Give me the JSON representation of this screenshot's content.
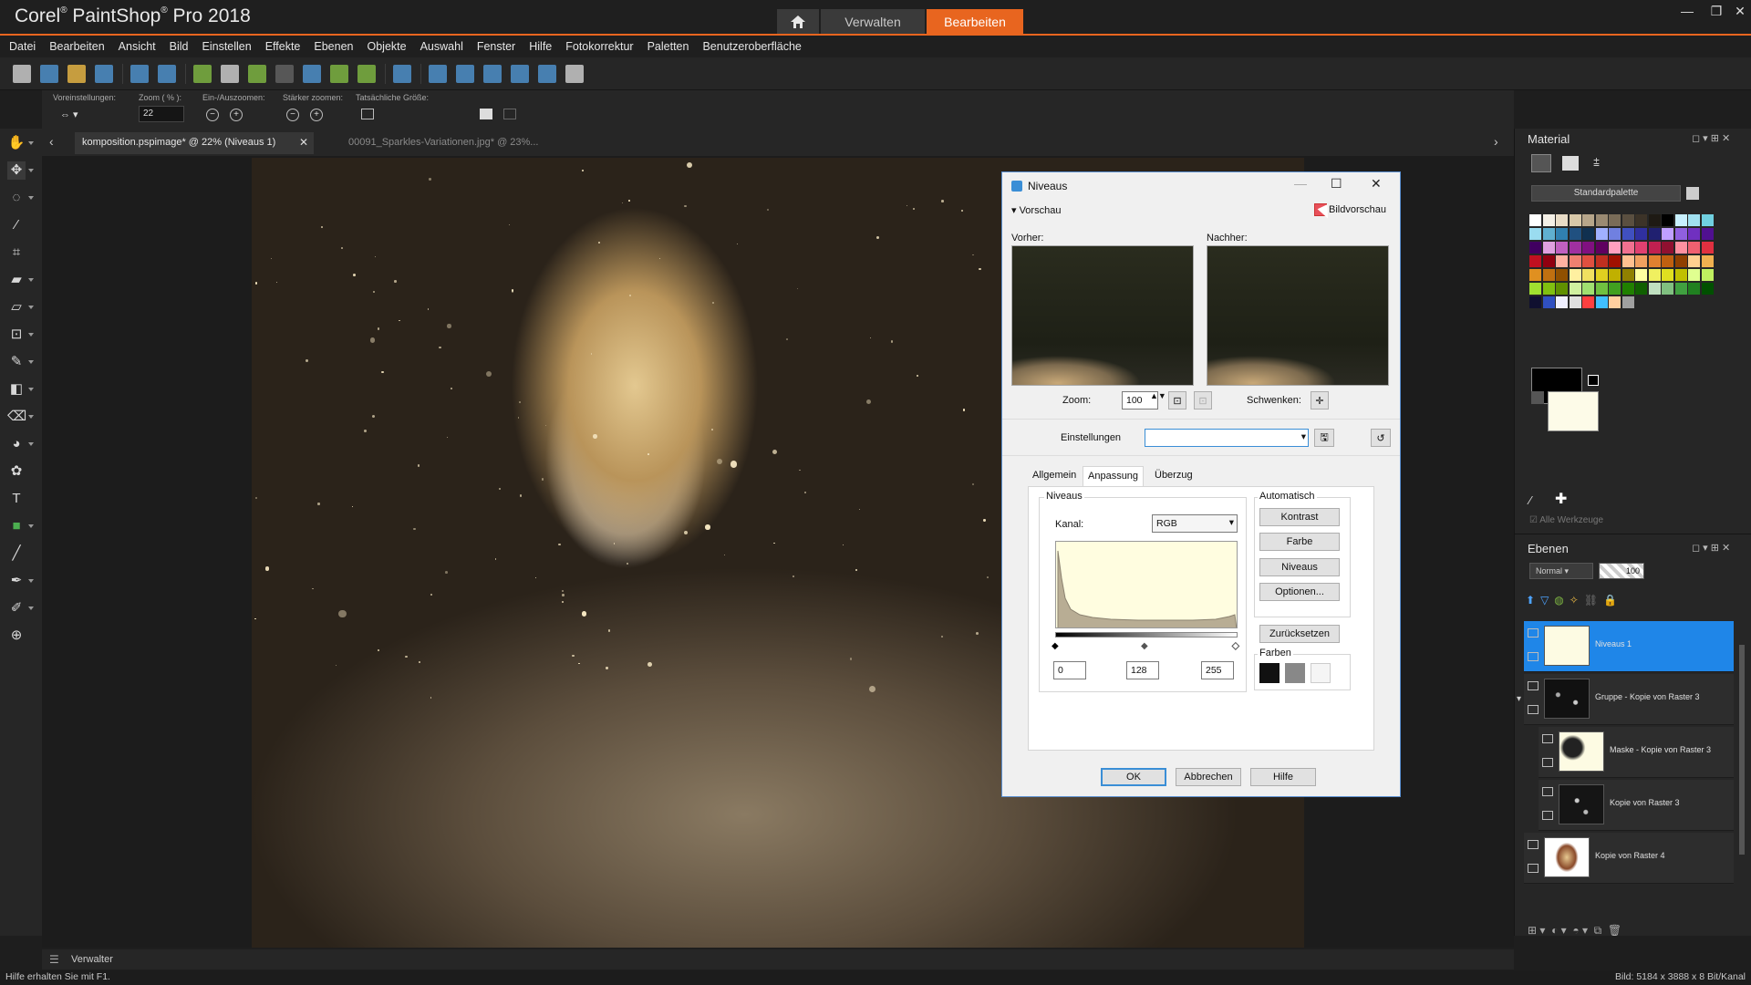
{
  "app": {
    "title_brand": "Corel",
    "title_product": "PaintShop",
    "title_rest": "Pro 2018",
    "home_icon": "home-icon",
    "tabs": [
      {
        "label": "Verwalten",
        "active": false
      },
      {
        "label": "Bearbeiten",
        "active": true
      }
    ],
    "accent": "#e8651f"
  },
  "menu": [
    "Datei",
    "Bearbeiten",
    "Ansicht",
    "Bild",
    "Einstellen",
    "Effekte",
    "Ebenen",
    "Objekte",
    "Auswahl",
    "Fenster",
    "Hilfe",
    "Fotokorrektur",
    "Paletten",
    "Benutzeroberfläche"
  ],
  "tool_options": {
    "presets_label": "Voreinstellungen:",
    "zoom_label": "Zoom ( % ):",
    "zoom_value": "22",
    "zoom_inout_label": "Ein-/Auszoomen:",
    "more_zoom_label": "Stärker zoomen:",
    "actual_size_label": "Tatsächliche Größe:"
  },
  "documents": {
    "active": "komposition.pspimage* @  22% (Niveaus 1)",
    "inactive": "00091_Sparkles-Variationen.jpg* @  23%..."
  },
  "dialog": {
    "title": "Niveaus",
    "preview_label": "Vorschau",
    "image_preview_label": "Bildvorschau",
    "before_label": "Vorher:",
    "after_label": "Nachher:",
    "zoom_label": "Zoom:",
    "zoom_value": "100",
    "pan_label": "Schwenken:",
    "settings_label": "Einstellungen",
    "tabs": [
      "Allgemein",
      "Anpassung",
      "Überzug"
    ],
    "active_tab": "Anpassung",
    "levels_group": "Niveaus",
    "channel_label": "Kanal:",
    "channel_value": "RGB",
    "input_low": "0",
    "input_mid": "128",
    "input_high": "255",
    "auto_group": "Automatisch",
    "auto_buttons": [
      "Kontrast",
      "Farbe",
      "Niveaus",
      "Optionen..."
    ],
    "reset_label": "Zurücksetzen",
    "colors_group": "Farben",
    "ok_label": "OK",
    "cancel_label": "Abbrechen",
    "help_label": "Hilfe"
  },
  "material": {
    "title": "Material",
    "palette_value": "Standardpalette",
    "all_tools_label": "Alle Werkzeuge"
  },
  "layers": {
    "title": "Ebenen",
    "blend_mode": "Normal",
    "opacity": "100",
    "items": [
      {
        "name": "Niveaus 1",
        "selected": true
      },
      {
        "name": "Gruppe - Kopie von Raster 3",
        "selected": false
      },
      {
        "name": "Maske - Kopie von Raster 3",
        "selected": false
      },
      {
        "name": "Kopie von Raster 3",
        "selected": false
      },
      {
        "name": "Kopie von Raster 4",
        "selected": false
      }
    ]
  },
  "organizer_label": "Verwalter",
  "status": {
    "left": "Hilfe erhalten Sie mit F1.",
    "right": "Bild:  5184 x 3888 x 8 Bit/Kanal"
  }
}
